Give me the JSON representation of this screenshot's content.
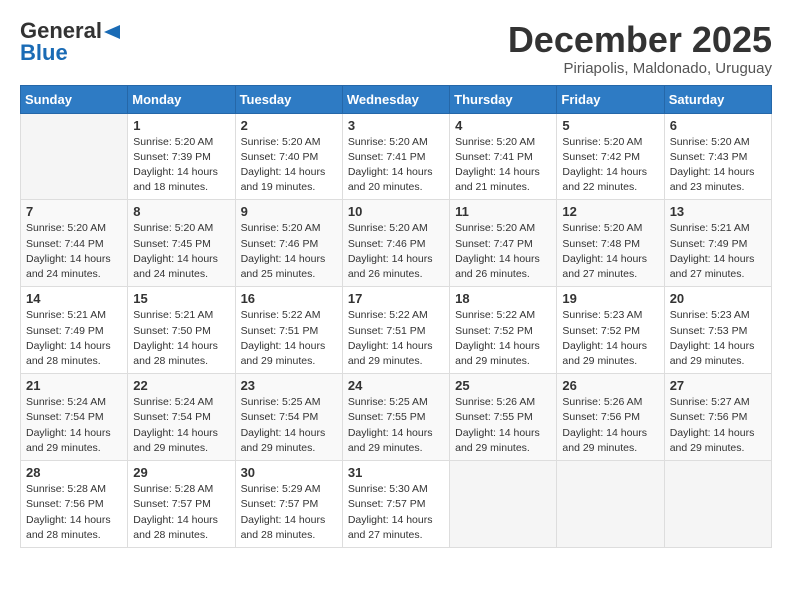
{
  "logo": {
    "general": "General",
    "blue": "Blue"
  },
  "header": {
    "month": "December 2025",
    "location": "Piriapolis, Maldonado, Uruguay"
  },
  "weekdays": [
    "Sunday",
    "Monday",
    "Tuesday",
    "Wednesday",
    "Thursday",
    "Friday",
    "Saturday"
  ],
  "weeks": [
    [
      {
        "day": "",
        "sunrise": "",
        "sunset": "",
        "daylight": ""
      },
      {
        "day": "1",
        "sunrise": "Sunrise: 5:20 AM",
        "sunset": "Sunset: 7:39 PM",
        "daylight": "Daylight: 14 hours and 18 minutes."
      },
      {
        "day": "2",
        "sunrise": "Sunrise: 5:20 AM",
        "sunset": "Sunset: 7:40 PM",
        "daylight": "Daylight: 14 hours and 19 minutes."
      },
      {
        "day": "3",
        "sunrise": "Sunrise: 5:20 AM",
        "sunset": "Sunset: 7:41 PM",
        "daylight": "Daylight: 14 hours and 20 minutes."
      },
      {
        "day": "4",
        "sunrise": "Sunrise: 5:20 AM",
        "sunset": "Sunset: 7:41 PM",
        "daylight": "Daylight: 14 hours and 21 minutes."
      },
      {
        "day": "5",
        "sunrise": "Sunrise: 5:20 AM",
        "sunset": "Sunset: 7:42 PM",
        "daylight": "Daylight: 14 hours and 22 minutes."
      },
      {
        "day": "6",
        "sunrise": "Sunrise: 5:20 AM",
        "sunset": "Sunset: 7:43 PM",
        "daylight": "Daylight: 14 hours and 23 minutes."
      }
    ],
    [
      {
        "day": "7",
        "sunrise": "Sunrise: 5:20 AM",
        "sunset": "Sunset: 7:44 PM",
        "daylight": "Daylight: 14 hours and 24 minutes."
      },
      {
        "day": "8",
        "sunrise": "Sunrise: 5:20 AM",
        "sunset": "Sunset: 7:45 PM",
        "daylight": "Daylight: 14 hours and 24 minutes."
      },
      {
        "day": "9",
        "sunrise": "Sunrise: 5:20 AM",
        "sunset": "Sunset: 7:46 PM",
        "daylight": "Daylight: 14 hours and 25 minutes."
      },
      {
        "day": "10",
        "sunrise": "Sunrise: 5:20 AM",
        "sunset": "Sunset: 7:46 PM",
        "daylight": "Daylight: 14 hours and 26 minutes."
      },
      {
        "day": "11",
        "sunrise": "Sunrise: 5:20 AM",
        "sunset": "Sunset: 7:47 PM",
        "daylight": "Daylight: 14 hours and 26 minutes."
      },
      {
        "day": "12",
        "sunrise": "Sunrise: 5:20 AM",
        "sunset": "Sunset: 7:48 PM",
        "daylight": "Daylight: 14 hours and 27 minutes."
      },
      {
        "day": "13",
        "sunrise": "Sunrise: 5:21 AM",
        "sunset": "Sunset: 7:49 PM",
        "daylight": "Daylight: 14 hours and 27 minutes."
      }
    ],
    [
      {
        "day": "14",
        "sunrise": "Sunrise: 5:21 AM",
        "sunset": "Sunset: 7:49 PM",
        "daylight": "Daylight: 14 hours and 28 minutes."
      },
      {
        "day": "15",
        "sunrise": "Sunrise: 5:21 AM",
        "sunset": "Sunset: 7:50 PM",
        "daylight": "Daylight: 14 hours and 28 minutes."
      },
      {
        "day": "16",
        "sunrise": "Sunrise: 5:22 AM",
        "sunset": "Sunset: 7:51 PM",
        "daylight": "Daylight: 14 hours and 29 minutes."
      },
      {
        "day": "17",
        "sunrise": "Sunrise: 5:22 AM",
        "sunset": "Sunset: 7:51 PM",
        "daylight": "Daylight: 14 hours and 29 minutes."
      },
      {
        "day": "18",
        "sunrise": "Sunrise: 5:22 AM",
        "sunset": "Sunset: 7:52 PM",
        "daylight": "Daylight: 14 hours and 29 minutes."
      },
      {
        "day": "19",
        "sunrise": "Sunrise: 5:23 AM",
        "sunset": "Sunset: 7:52 PM",
        "daylight": "Daylight: 14 hours and 29 minutes."
      },
      {
        "day": "20",
        "sunrise": "Sunrise: 5:23 AM",
        "sunset": "Sunset: 7:53 PM",
        "daylight": "Daylight: 14 hours and 29 minutes."
      }
    ],
    [
      {
        "day": "21",
        "sunrise": "Sunrise: 5:24 AM",
        "sunset": "Sunset: 7:54 PM",
        "daylight": "Daylight: 14 hours and 29 minutes."
      },
      {
        "day": "22",
        "sunrise": "Sunrise: 5:24 AM",
        "sunset": "Sunset: 7:54 PM",
        "daylight": "Daylight: 14 hours and 29 minutes."
      },
      {
        "day": "23",
        "sunrise": "Sunrise: 5:25 AM",
        "sunset": "Sunset: 7:54 PM",
        "daylight": "Daylight: 14 hours and 29 minutes."
      },
      {
        "day": "24",
        "sunrise": "Sunrise: 5:25 AM",
        "sunset": "Sunset: 7:55 PM",
        "daylight": "Daylight: 14 hours and 29 minutes."
      },
      {
        "day": "25",
        "sunrise": "Sunrise: 5:26 AM",
        "sunset": "Sunset: 7:55 PM",
        "daylight": "Daylight: 14 hours and 29 minutes."
      },
      {
        "day": "26",
        "sunrise": "Sunrise: 5:26 AM",
        "sunset": "Sunset: 7:56 PM",
        "daylight": "Daylight: 14 hours and 29 minutes."
      },
      {
        "day": "27",
        "sunrise": "Sunrise: 5:27 AM",
        "sunset": "Sunset: 7:56 PM",
        "daylight": "Daylight: 14 hours and 29 minutes."
      }
    ],
    [
      {
        "day": "28",
        "sunrise": "Sunrise: 5:28 AM",
        "sunset": "Sunset: 7:56 PM",
        "daylight": "Daylight: 14 hours and 28 minutes."
      },
      {
        "day": "29",
        "sunrise": "Sunrise: 5:28 AM",
        "sunset": "Sunset: 7:57 PM",
        "daylight": "Daylight: 14 hours and 28 minutes."
      },
      {
        "day": "30",
        "sunrise": "Sunrise: 5:29 AM",
        "sunset": "Sunset: 7:57 PM",
        "daylight": "Daylight: 14 hours and 28 minutes."
      },
      {
        "day": "31",
        "sunrise": "Sunrise: 5:30 AM",
        "sunset": "Sunset: 7:57 PM",
        "daylight": "Daylight: 14 hours and 27 minutes."
      },
      {
        "day": "",
        "sunrise": "",
        "sunset": "",
        "daylight": ""
      },
      {
        "day": "",
        "sunrise": "",
        "sunset": "",
        "daylight": ""
      },
      {
        "day": "",
        "sunrise": "",
        "sunset": "",
        "daylight": ""
      }
    ]
  ]
}
